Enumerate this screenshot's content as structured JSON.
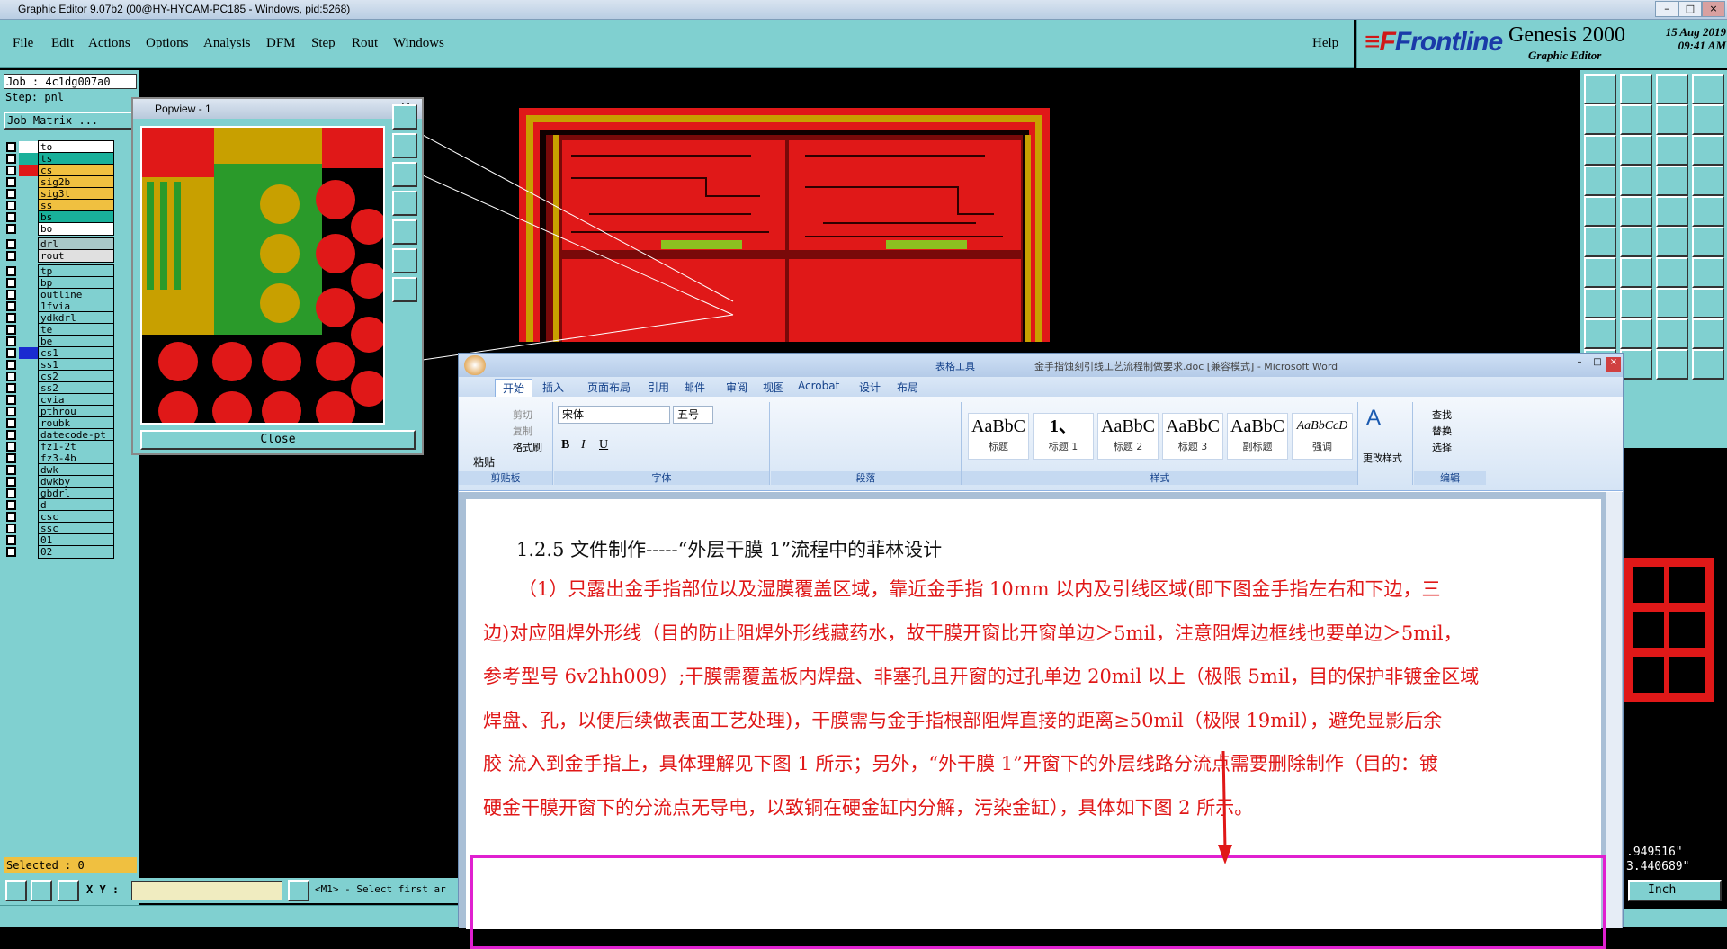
{
  "window_title": "Graphic Editor 9.07b2 (00@HY-HYCAM-PC185 - Windows, pid:5268)",
  "menu": [
    "File",
    "Edit",
    "Actions",
    "Options",
    "Analysis",
    "DFM",
    "Step",
    "Rout",
    "Windows"
  ],
  "help": "Help",
  "brand": {
    "logo": "Frontline",
    "product": "Genesis 2000",
    "subtitle": "Graphic Editor",
    "date": "15 Aug 2019",
    "time": "09:41 AM"
  },
  "job": "Job : 4c1dg007a0",
  "step": "Step: pnl",
  "job_matrix": "Job Matrix ...",
  "layers": [
    {
      "name": "to",
      "color": "#ffffff",
      "cb": "#ffffff"
    },
    {
      "name": "ts",
      "color": "#19b09a",
      "cb": "#19b09a"
    },
    {
      "name": "cs",
      "color": "#f0c040",
      "cb": "#e01818"
    },
    {
      "name": "sig2b",
      "color": "#f0c040",
      "cb": "#80d0d0"
    },
    {
      "name": "sig3t",
      "color": "#f0c040",
      "cb": "#80d0d0"
    },
    {
      "name": "ss",
      "color": "#f0c040",
      "cb": "#80d0d0"
    },
    {
      "name": "bs",
      "color": "#19b09a",
      "cb": "#80d0d0"
    },
    {
      "name": "bo",
      "color": "#ffffff",
      "cb": "#80d0d0"
    },
    {
      "name": "drl",
      "color": "#a8c8c8",
      "cb": "#80d0d0"
    },
    {
      "name": "rout",
      "color": "#e0e0e0",
      "cb": "#80d0d0"
    },
    {
      "name": "tp",
      "color": "#80d0d0",
      "cb": "#80d0d0"
    },
    {
      "name": "bp",
      "color": "#80d0d0",
      "cb": "#80d0d0"
    },
    {
      "name": "outline",
      "color": "#80d0d0",
      "cb": "#80d0d0"
    },
    {
      "name": "1fvia",
      "color": "#80d0d0",
      "cb": "#80d0d0"
    },
    {
      "name": "ydkdrl",
      "color": "#80d0d0",
      "cb": "#80d0d0"
    },
    {
      "name": "te",
      "color": "#80d0d0",
      "cb": "#80d0d0"
    },
    {
      "name": "be",
      "color": "#80d0d0",
      "cb": "#80d0d0"
    },
    {
      "name": "cs1",
      "color": "#80d0d0",
      "cb": "#1a2bd0"
    },
    {
      "name": "ss1",
      "color": "#80d0d0",
      "cb": "#80d0d0"
    },
    {
      "name": "cs2",
      "color": "#80d0d0",
      "cb": "#80d0d0"
    },
    {
      "name": "ss2",
      "color": "#80d0d0",
      "cb": "#80d0d0"
    },
    {
      "name": "cvia",
      "color": "#80d0d0",
      "cb": "#80d0d0"
    },
    {
      "name": "pthrou",
      "color": "#80d0d0",
      "cb": "#80d0d0"
    },
    {
      "name": "roubk",
      "color": "#80d0d0",
      "cb": "#80d0d0"
    },
    {
      "name": "datecode-pt",
      "color": "#80d0d0",
      "cb": "#80d0d0"
    },
    {
      "name": "fz1-2t",
      "color": "#80d0d0",
      "cb": "#80d0d0"
    },
    {
      "name": "fz3-4b",
      "color": "#80d0d0",
      "cb": "#80d0d0"
    },
    {
      "name": "dwk",
      "color": "#80d0d0",
      "cb": "#80d0d0"
    },
    {
      "name": "dwkby",
      "color": "#80d0d0",
      "cb": "#80d0d0"
    },
    {
      "name": "gbdrl",
      "color": "#80d0d0",
      "cb": "#80d0d0"
    },
    {
      "name": "d",
      "color": "#80d0d0",
      "cb": "#80d0d0"
    },
    {
      "name": "csc",
      "color": "#80d0d0",
      "cb": "#80d0d0"
    },
    {
      "name": "ssc",
      "color": "#80d0d0",
      "cb": "#80d0d0"
    },
    {
      "name": "01",
      "color": "#80d0d0",
      "cb": "#80d0d0"
    },
    {
      "name": "02",
      "color": "#80d0d0",
      "cb": "#80d0d0"
    }
  ],
  "selected": "Selected : 0",
  "xy_label": "X Y :",
  "prompt": "<M1> - Select first ar",
  "popview": {
    "title": "Popview - 1",
    "close": "Close"
  },
  "coords": {
    "x": ".949516\"",
    "y": "3.440689\""
  },
  "units": "Inch",
  "word": {
    "title": "金手指蚀刻引线工艺流程制做要求.doc [兼容模式] - Microsoft Word",
    "context_tab": "表格工具",
    "tabs": [
      "开始",
      "插入",
      "页面布局",
      "引用",
      "邮件",
      "审阅",
      "视图",
      "Acrobat",
      "设计",
      "布局"
    ],
    "clipboard": {
      "paste": "粘贴",
      "cut": "剪切",
      "copy": "复制",
      "format": "格式刷",
      "label": "剪贴板"
    },
    "font": {
      "name": "宋体",
      "size": "五号",
      "label": "字体"
    },
    "paragraph_label": "段落",
    "styles": [
      {
        "sample": "AaBbC",
        "name": "标题"
      },
      {
        "sample": "1、",
        "name": "标题 1"
      },
      {
        "sample": "AaBbC",
        "name": "标题 2"
      },
      {
        "sample": "AaBbC",
        "name": "标题 3"
      },
      {
        "sample": "AaBbC",
        "name": "副标题"
      },
      {
        "sample": "AaBbCcD",
        "name": "强调"
      }
    ],
    "styles_label": "样式",
    "change_styles": "更改样式",
    "edit": {
      "find": "查找",
      "replace": "替换",
      "select": "选择",
      "label": "编辑"
    },
    "heading": "1.2.5 文件制作-----“外层干膜 1”流程中的菲林设计",
    "lines": [
      "（1）只露出金手指部位以及湿膜覆盖区域，靠近金手指 10mm 以内及引线区域(即下图金手指左右和下边，三",
      "边)对应阻焊外形线（目的防止阻焊外形线藏药水，故干膜开窗比开窗单边＞5mil，注意阻焊边框线也要单边＞5mil，",
      "参考型号 6v2hh009）;干膜需覆盖板内焊盘、非塞孔且开窗的过孔单边 20mil 以上（极限 5mil，目的保护非镀金区域",
      "焊盘、孔，以便后续做表面工艺处理)，干膜需与金手指根部阻焊直接的距离≥50mil（极限 19mil），避免显影后余",
      "胶  流入到金手指上，具体理解见下图 1 所示；另外，“外干膜 1”开窗下的外层线路分流点需要删除制作（目的：镀",
      "硬金干膜开窗下的分流点无导电，以致铜在硬金缸内分解，污染金缸），具体如下图 2 所示。"
    ]
  }
}
